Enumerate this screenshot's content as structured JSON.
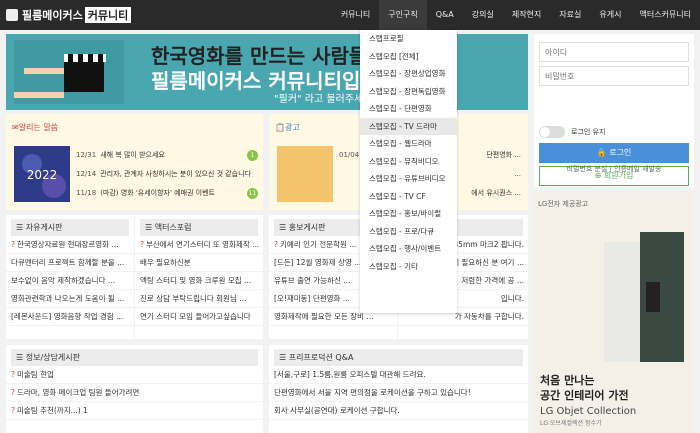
{
  "logo": {
    "part1": "필름메이커스",
    "part2": "커뮤니티"
  },
  "nav": [
    "커뮤니티",
    "구인구직",
    "Q&A",
    "강의실",
    "제작현지",
    "자료실",
    "유게시",
    "액터스커뮤니티"
  ],
  "banner": {
    "line1": "한국영화를 만드는 사람들.",
    "line2": "필름메이커스 커뮤니티입니다.",
    "line3": "\"필커\" 라고 불러주세요."
  },
  "login": {
    "id_placeholder": "아이디",
    "pw_placeholder": "비밀번호",
    "remember": "로그인 유지",
    "login_btn": "로그인",
    "join_btn": "회원가입",
    "find": "비밀번호 분실 | 인증메일 재발송"
  },
  "notice": {
    "title": "알리는 말씀",
    "thumb_text": "2022",
    "rows": [
      {
        "date": "12/31",
        "text": "새해 복 많이 받으세요",
        "badge": "1"
      },
      {
        "date": "12/14",
        "text": "관리자, 관계자 사칭하시는 분이 있으신 것 같습니다",
        "badge": ""
      },
      {
        "date": "11/18",
        "text": "(마감) 영화 '유세이향자' 예매권 이벤트",
        "badge": "11"
      }
    ]
  },
  "ad": {
    "title": "광고",
    "rows": [
      {
        "date": "01/04",
        "text": "단편영화 ..."
      },
      {
        "date": "",
        "text": "..."
      },
      {
        "date": "",
        "text": "에서 유시퀀스 ..."
      }
    ]
  },
  "dropdown": [
    "스탭프로필",
    "스탭모집 [전체]",
    "스탭모집 - 장편상업영화",
    "스탭모집 - 장편독립영화",
    "스탭모집 - 단편영화",
    "스탭모집 - TV 드라마",
    "스탭모집 - 웹드라마",
    "스탭모집 - 뮤직비디오",
    "스탭모집 - 유튜브비디오",
    "스탭모집 - TV CF",
    "스탭모집 - 홍보/바이럴",
    "스탭모집 - 프로/다큐",
    "스탭모집 - 행사/이벤트",
    "스탭모집 - 기타"
  ],
  "boards": {
    "free": {
      "title": "자유게시판",
      "items": [
        "한국영상자료원 현대장르영화 ...",
        "다큐멘터리 프로젝트 함께할 분을 ...",
        "보수없이 음악 제작하겠습니다 ...",
        "영화관련학과 나오는게 도움이 될 ...",
        "[레몬사운드] 영화음향 작업 경험 ..."
      ]
    },
    "actor": {
      "title": "액터스포럼",
      "items": [
        "부산에서 연기스터디 또 영화제작 ...",
        "배우 필요하신분",
        "액팅 스터디 및 영화 크루원 모집 ...",
        "진로 상담 부탁드립니다 회원님 ...",
        "연기 스터디 모임 들어가고싶습니다"
      ]
    },
    "promo": {
      "title": "홍보게시판",
      "items": [
        "키예리 인기 전문학원 ...",
        "[드든] 12월 영화제 상영 ...",
        "유튜브 출연 가능하신 ...",
        "[오!재미동] 단편영화 ...",
        "영화제작에 필요한 모든 장비 ..."
      ]
    },
    "market": {
      "title": "",
      "items": [
        "35mm 마크2 팝니다.",
        "에 필요하신 분 여기 ...",
        "저렴한 가격에 공 ...",
        "입니다.",
        "가 자동차를 구합니다."
      ]
    },
    "info": {
      "title": "정보/상담게시판",
      "items": [
        "미술팀 현업",
        "드라마, 영화 메이크업 팀원 들어가려면",
        "미술팀 추천(까지...) 1"
      ]
    },
    "qa": {
      "title": "프리프로덕션 Q&A",
      "items": [
        "[서울,구로] 1.5룸,원룸 오피스텔 대관해 드려요.",
        "단편영화에서 서울 지역 편의점을 로케이션을 구하고 있습니다!",
        "회사 사무실(공연대) 로케이션 구합니다."
      ]
    }
  },
  "sidead": {
    "brand": "LG전자 제공광고",
    "line1": "처음 만나는",
    "line2": "공간 인테리어 가전",
    "line3": "LG Objet Collection",
    "line4": "LG 오브제컬렉션 정수기"
  },
  "colors": {
    "topbar": "#2a2a2a",
    "banner": "#4aa7b0",
    "login": "#4a90d9",
    "join": "#5aaa5a",
    "notice_bg": "#fff8e3"
  }
}
